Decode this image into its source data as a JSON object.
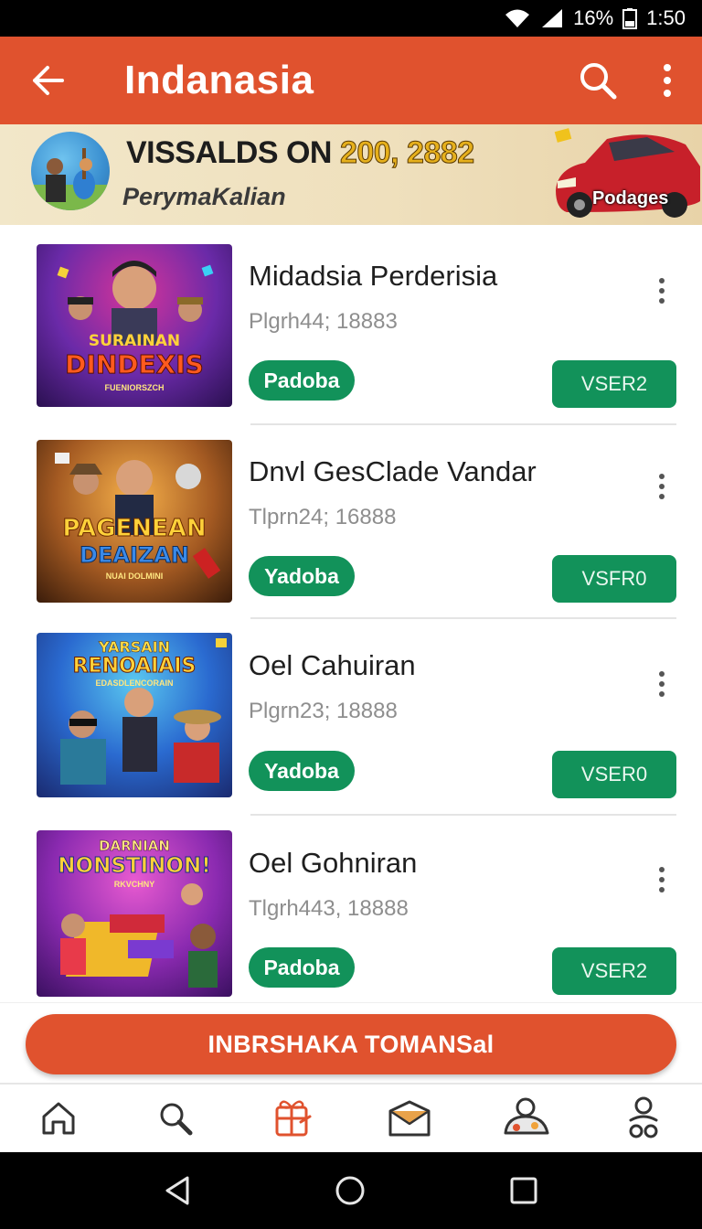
{
  "status_bar": {
    "battery": "16%",
    "time": "1:50"
  },
  "app_bar": {
    "title": "Indanasia"
  },
  "banner": {
    "headline_text": "VISSALDS ON",
    "headline_numbers": "200, 2882",
    "subtitle": "PerymaKalian",
    "car_label": "Podages"
  },
  "items": [
    {
      "thumb_title_1": "SURAINAN",
      "thumb_title_2": "DINDEXIS",
      "thumb_sub": "FUENIORSZCH",
      "title": "Midadsia Perderisia",
      "subtitle": "Plgrh44; 18883",
      "tag": "Padoba",
      "button": "VSER2"
    },
    {
      "thumb_title_1": "PAGENEAN",
      "thumb_title_2": "DEAIZAN",
      "thumb_sub": "NUAI DOLMINI",
      "title": "Dnvl GesClade Vandar",
      "subtitle": "Tlprn24; 16888",
      "tag": "Yadoba",
      "button": "VSFR0"
    },
    {
      "thumb_title_1": "YARSAIN",
      "thumb_title_2": "RENOAIAIS",
      "thumb_sub": "EDASDLENCORAIN",
      "title": "Oel Cahuiran",
      "subtitle": "Plgrn23; 18888",
      "tag": "Yadoba",
      "button": "VSER0"
    },
    {
      "thumb_title_1": "DARNIAN",
      "thumb_title_2": "NONSTINON!",
      "thumb_sub": "RKVCHNY",
      "title": "Oel Gohniran",
      "subtitle": "Tlgrh443, 18888",
      "tag": "Padoba",
      "button": "VSER2"
    }
  ],
  "cta": {
    "label": "INBRSHAKA TOMANSal"
  },
  "colors": {
    "primary": "#e0522e",
    "accent_green": "#12925a"
  },
  "bottom_nav": {
    "items": [
      "home-icon",
      "search-icon",
      "gift-icon",
      "mail-icon",
      "profile-icon",
      "account-icon"
    ]
  }
}
